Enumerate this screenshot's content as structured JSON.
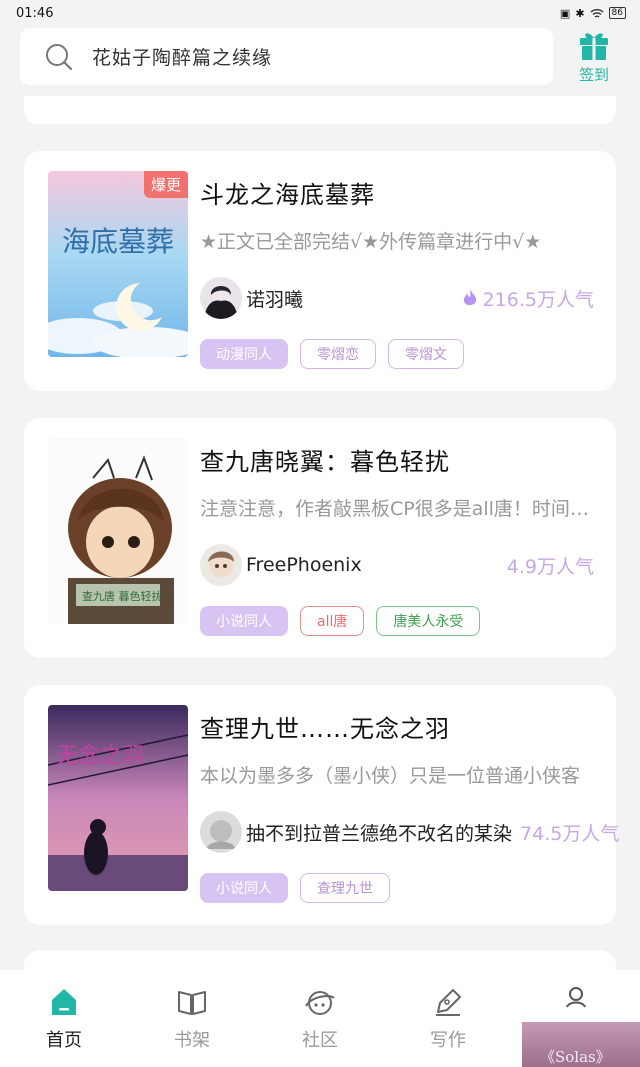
{
  "status_bar": {
    "time": "01:46",
    "battery": "86"
  },
  "search": {
    "placeholder_text": "花姑子陶醉篇之续缘"
  },
  "checkin": {
    "label": "签到",
    "icon": "gift-icon"
  },
  "books": [
    {
      "title": "斗龙之海底墓葬",
      "badge": "爆更",
      "description": "★正文已全部完结√★外传篇章进行中√★",
      "author": "诺羽曦",
      "popularity": "216.5万人气",
      "tags": [
        "动漫同人",
        "零熠恋",
        "零熠文"
      ],
      "cover_text": "海底墓葬"
    },
    {
      "title": "查九唐晓翼：暮色轻扰",
      "description": "注意注意，作者敲黑板CP很多是all唐！时间线混乱",
      "author": "FreePhoenix",
      "popularity": "4.9万人气",
      "tags": [
        "小说同人",
        "all唐",
        "唐美人永受"
      ],
      "cover_text": "查九唐 暮色轻扰"
    },
    {
      "title": "查理九世……无念之羽",
      "description": "本以为墨多多（墨小侠）只是一位普通小侠客",
      "author": "抽不到拉普兰德绝不改名的某染",
      "popularity": "74.5万人气",
      "tags": [
        "小说同人",
        "查理九世"
      ],
      "cover_text": "无念之羽"
    }
  ],
  "nav": [
    {
      "label": "首页",
      "icon": "home-icon",
      "active": true
    },
    {
      "label": "书架",
      "icon": "book-icon",
      "active": false
    },
    {
      "label": "社区",
      "icon": "planet-icon",
      "active": false
    },
    {
      "label": "写作",
      "icon": "pen-icon",
      "active": false
    },
    {
      "label": "",
      "icon": "user-icon",
      "active": false
    }
  ],
  "floating_preview": {
    "text": "《Solas》"
  },
  "colors": {
    "accent": "#22b6a6",
    "badge": "#f2706d",
    "popularity": "#c6a8e6"
  }
}
